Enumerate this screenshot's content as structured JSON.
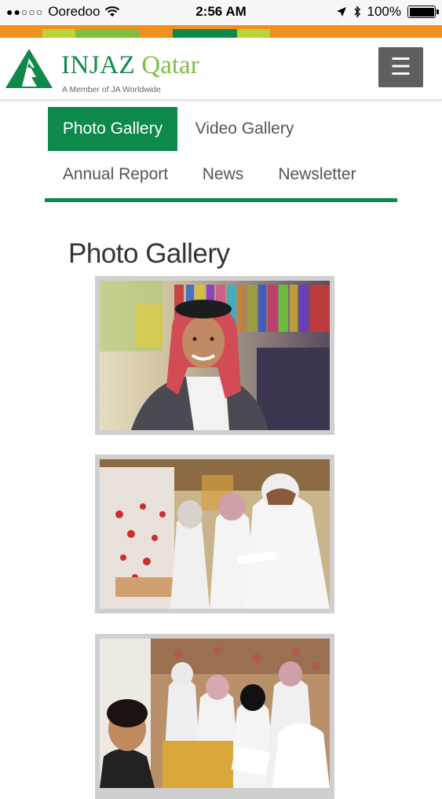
{
  "status_bar": {
    "signal": "●●○○○",
    "carrier": "Ooredoo",
    "time": "2:56 AM",
    "battery": "100%"
  },
  "colors": {
    "brand_green": "#0d8a4b",
    "light_green": "#7fbf3f",
    "orange": "#f0901d",
    "menu_gray": "#5f5f5f"
  },
  "header": {
    "brand_word1": "INJAZ",
    "brand_word2": "Qatar",
    "tagline": "A Member of JA Worldwide",
    "menu_icon": "☰"
  },
  "nav": {
    "photo_gallery": "Photo Gallery",
    "video_gallery": "Video Gallery",
    "annual_report": "Annual Report",
    "news": "News",
    "newsletter": "Newsletter",
    "active": "Photo Gallery"
  },
  "page_title": "Photo Gallery"
}
